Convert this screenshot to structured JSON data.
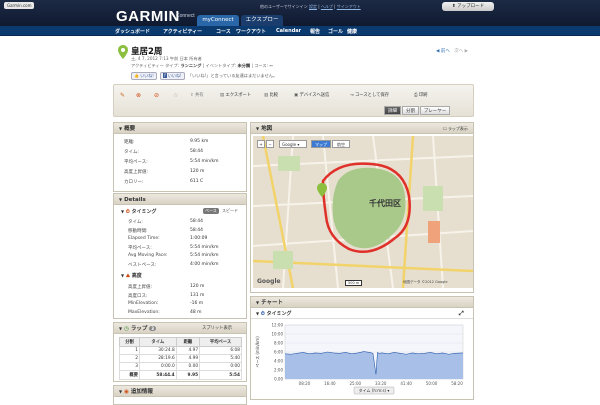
{
  "header": {
    "garmin_link": "Garmin.com",
    "logo_text": "GARMIN",
    "connect_text": "Connect",
    "tabs": [
      "myConnect",
      "エクスプロー"
    ],
    "user_text": "他のユーザーでサインイン",
    "links": [
      "設定",
      "ヘルプ",
      "サインアウト"
    ],
    "upload_label": "アップロード"
  },
  "nav": {
    "items": [
      "ダッシュボード",
      "アクティビティー",
      "コース",
      "ワークアウト",
      "Calendar",
      "報告",
      "ゴール",
      "健康"
    ]
  },
  "activity": {
    "title": "皇居2周",
    "date_line": "土, 4 7, 2012 7:13 午前 日本 所有者",
    "type_label": "アクティビティー タイプ:",
    "type_value": "ランニング",
    "event_label": "| イベントタイプ:",
    "event_value": "未分類",
    "course_label": "| コース:",
    "course_value": "--",
    "like_button": "いいね!",
    "like_button2": "いいね!",
    "like_text": "「いいね!」と言っている友達はまだいません。",
    "prev": "前へ",
    "next": "次へ"
  },
  "toolbar": {
    "actions": [
      "共有",
      "エクスポート",
      "比較",
      "デバイスへ送信",
      "コースとして保存",
      "印刷"
    ],
    "view_buttons": [
      "詳細",
      "分割",
      "プレーヤー"
    ]
  },
  "summary": {
    "heading": "概要",
    "rows": [
      {
        "label": "距離:",
        "value": "9.95 km"
      },
      {
        "label": "タイム:",
        "value": "58:44"
      },
      {
        "label": "平均ペース:",
        "value": "5:54 min/km"
      },
      {
        "label": "高度上昇値:",
        "value": "120 m"
      },
      {
        "label": "カロリー:",
        "value": "611 C"
      }
    ]
  },
  "details": {
    "heading": "Details",
    "timing_heading": "タイミング",
    "segment": [
      "ペース",
      "スピード"
    ],
    "timing_rows": [
      {
        "label": "タイム:",
        "value": "58:44"
      },
      {
        "label": "移動時間:",
        "value": "58:44"
      },
      {
        "label": "Elapsed Time:",
        "value": "1:00:09"
      },
      {
        "label": "平均ペース:",
        "value": "5:54 min/km"
      },
      {
        "label": "Avg Moving Pace:",
        "value": "5:54 min/km"
      },
      {
        "label": "ベストペース:",
        "value": "4:00 min/km"
      }
    ],
    "elevation_heading": "高度",
    "elevation_rows": [
      {
        "label": "高度上昇値:",
        "value": "120 m"
      },
      {
        "label": "高度ロス:",
        "value": "131 m"
      },
      {
        "label": "MinElevation:",
        "value": "-16 m"
      },
      {
        "label": "MaxElevation:",
        "value": "48 m"
      }
    ]
  },
  "laps": {
    "heading": "ラップ",
    "count": "3",
    "link": "スプリット表示",
    "columns": [
      "分割",
      "タイム",
      "距離",
      "平均ペース"
    ],
    "rows": [
      [
        "1",
        "30:24.8",
        "4.97",
        "6:08"
      ],
      [
        "2",
        "28:19.6",
        "4.99",
        "5:40"
      ],
      [
        "3",
        "0:00.0",
        "0.00",
        "0:00"
      ]
    ],
    "summary_row": [
      "概要",
      "58:44.4",
      "9.95",
      "5:54"
    ]
  },
  "extra": {
    "heading": "追加情報"
  },
  "map": {
    "heading": "地図",
    "lap_toggle": "ラップ表示",
    "map_type": "Google",
    "map_btn": "マップ",
    "sat_btn": "航空",
    "district": "千代田区",
    "attribution": "Google",
    "scale": "500 m",
    "copyright": "地図データ ©2012 Google"
  },
  "chart": {
    "heading": "チャート",
    "sub_heading": "タイミング",
    "ylabel": "ペース (min/km)",
    "xlabel": "タイム (h:m:s)"
  },
  "chart_data": {
    "type": "area",
    "title": "タイミング",
    "xlabel": "タイム (h:m:s)",
    "ylabel": "ペース (min/km)",
    "x_ticks": [
      "08:20",
      "16:40",
      "25:00",
      "33:20",
      "41:40",
      "50:00",
      "58:20"
    ],
    "y_ticks": [
      "0.00",
      "2:00",
      "4:00",
      "6:00",
      "8:00",
      "10:00",
      "12:00"
    ],
    "ylim": [
      0,
      12
    ],
    "xlim": [
      0,
      58.7
    ],
    "series": [
      {
        "x": [
          0,
          2,
          4,
          6,
          8,
          10,
          12,
          14,
          16,
          18,
          20,
          22,
          24,
          26,
          28,
          29,
          30,
          30.5,
          31,
          32,
          34,
          36,
          38,
          40,
          42,
          44,
          46,
          48,
          50,
          52,
          54,
          56,
          58.7
        ],
        "values": [
          5.6,
          5.5,
          5.7,
          5.9,
          5.6,
          5.8,
          5.7,
          6.0,
          5.8,
          5.7,
          5.9,
          5.6,
          5.8,
          6.1,
          5.9,
          5.7,
          1.0,
          5.9,
          5.7,
          5.8,
          5.6,
          5.9,
          5.7,
          5.5,
          5.8,
          5.6,
          5.7,
          5.9,
          5.6,
          5.8,
          5.5,
          5.7,
          5.8
        ]
      }
    ],
    "colors": {
      "fill": "#a8c0e8",
      "line": "#2a5aa8"
    }
  }
}
